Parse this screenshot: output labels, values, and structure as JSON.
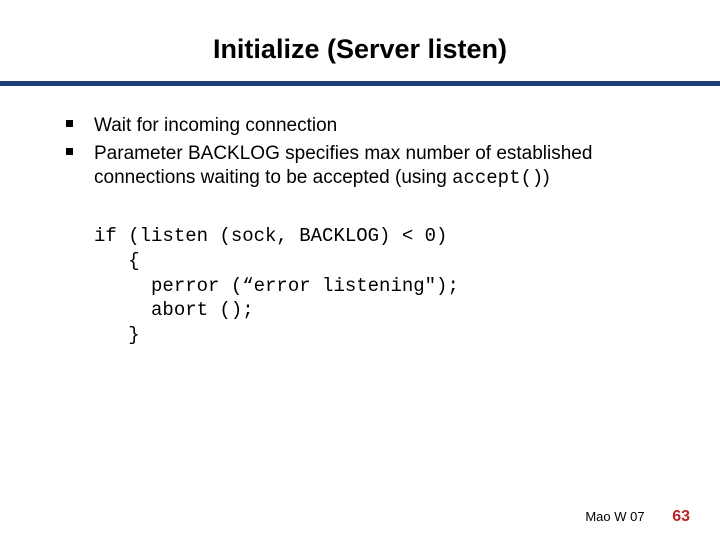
{
  "title": "Initialize (Server listen)",
  "bullets": [
    {
      "text": "Wait for incoming connection"
    },
    {
      "text_prefix": "Parameter BACKLOG specifies max number of established connections waiting to be accepted (using ",
      "code": "accept()",
      "text_suffix": ")"
    }
  ],
  "code_lines": [
    "if (listen (sock, BACKLOG) < 0)",
    "   {",
    "     perror (“error listening\");",
    "     abort ();",
    "   }"
  ],
  "footer": {
    "attribution": "Mao W 07",
    "page": "63"
  },
  "colors": {
    "divider": "#1f3e7a",
    "pagenum": "#b82426"
  }
}
